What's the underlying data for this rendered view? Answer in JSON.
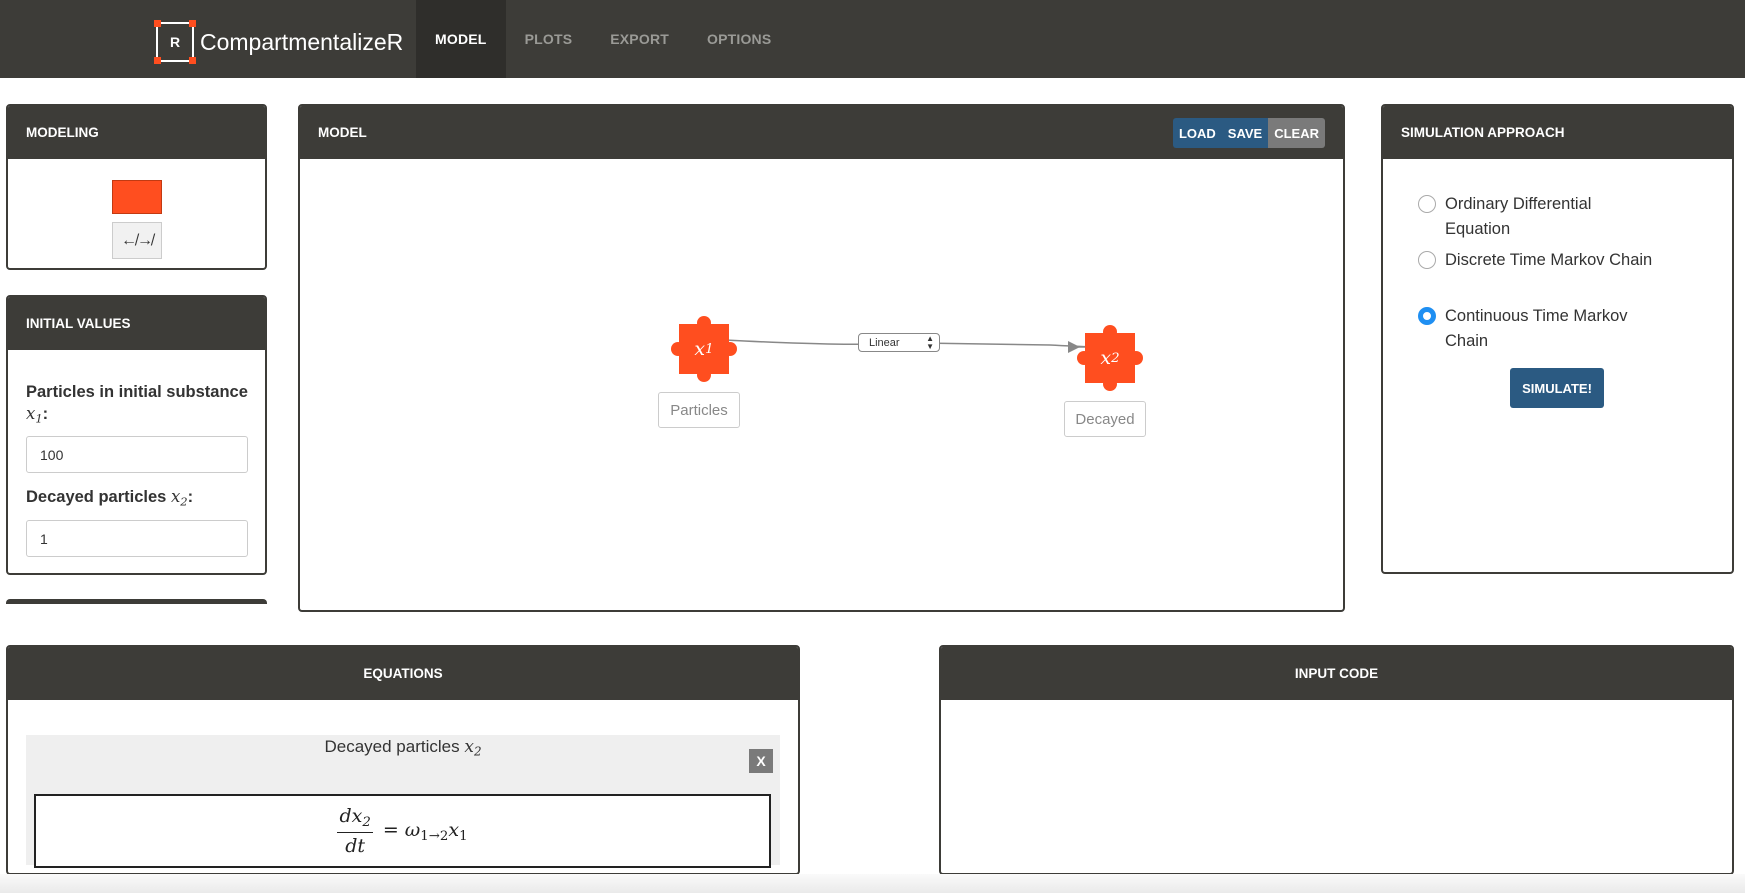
{
  "app": {
    "title": "CompartmentalizeR",
    "logo_letter": "R"
  },
  "nav": {
    "tabs": [
      {
        "label": "MODEL",
        "active": true
      },
      {
        "label": "PLOTS",
        "active": false
      },
      {
        "label": "EXPORT",
        "active": false
      },
      {
        "label": "OPTIONS",
        "active": false
      }
    ]
  },
  "modeling": {
    "title": "MODELING",
    "compartment_color": "#ff4e1f",
    "arrow_tool_icon": "↚↛"
  },
  "initial_values": {
    "title": "INITIAL VALUES",
    "fields": [
      {
        "label": "Particles in initial substance",
        "var": "x",
        "sub": "1",
        "suffix": ":",
        "value": "100"
      },
      {
        "label": "Decayed particles",
        "var": "x",
        "sub": "2",
        "suffix": ":",
        "value": "1"
      }
    ]
  },
  "model": {
    "title": "MODEL",
    "buttons": {
      "load": "LOAD",
      "save": "SAVE",
      "clear": "CLEAR"
    },
    "nodes": [
      {
        "var": "x",
        "sub": "1",
        "name": "Particles"
      },
      {
        "var": "x",
        "sub": "2",
        "name": "Decayed"
      }
    ],
    "edge": {
      "rate_type": "Linear"
    }
  },
  "simulation": {
    "title": "SIMULATION APPROACH",
    "options": [
      {
        "label": "Ordinary Differential Equation",
        "checked": false
      },
      {
        "label": "Discrete Time Markov Chain",
        "checked": false
      },
      {
        "label": "Continuous Time Markov Chain",
        "checked": true
      }
    ],
    "button": "SIMULATE!"
  },
  "equations": {
    "title": "EQUATIONS",
    "entry": {
      "heading": "Decayed particles",
      "heading_var": "x",
      "heading_sub": "2",
      "close": "X",
      "numerator_d": "dx",
      "numerator_sub": "2",
      "denominator": "dt",
      "equals": "=",
      "omega": "ω",
      "omega_sub": "1→2",
      "rhs_var": "x",
      "rhs_sub": "1"
    }
  },
  "input_code": {
    "title": "INPUT CODE"
  },
  "colors": {
    "accent": "#ff4e1f",
    "dark": "#3d3c38",
    "primary": "#2b5a82",
    "radio": "#1f8ff2"
  }
}
